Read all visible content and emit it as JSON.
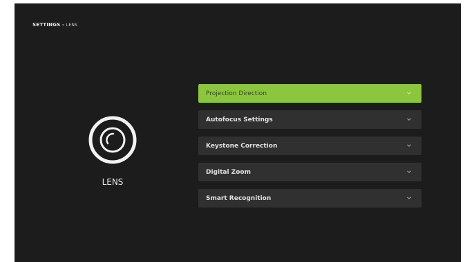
{
  "header": {
    "section": "SETTINGS -",
    "current": "LENS"
  },
  "category": {
    "label": "LENS",
    "icon": "lens-icon"
  },
  "menu": {
    "items": [
      {
        "label": "Projection Direction",
        "selected": true,
        "icon": "chevron-down-icon"
      },
      {
        "label": "Autofocus Settings",
        "selected": false,
        "icon": "chevron-down-icon"
      },
      {
        "label": "Keystone Correction",
        "selected": false,
        "icon": "chevron-down-icon"
      },
      {
        "label": "Digital Zoom",
        "selected": false,
        "icon": "chevron-down-icon"
      },
      {
        "label": "Smart Recognition",
        "selected": false,
        "icon": "chevron-down-icon"
      }
    ]
  },
  "colors": {
    "background": "#1c1c1c",
    "item_background": "#303030",
    "accent": "#8cc63f"
  }
}
